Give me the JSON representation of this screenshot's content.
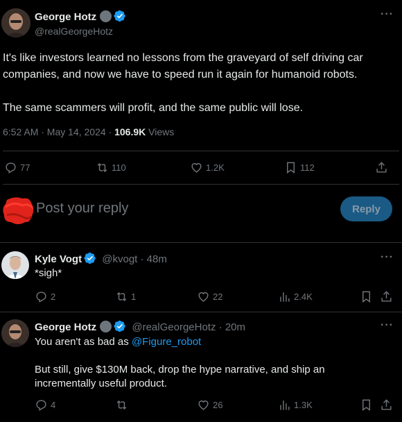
{
  "main_post": {
    "author_name": "George Hotz",
    "author_handle": "@realGeorgeHotz",
    "paragraph1_line1": "It's like investors learned no lessons from the graveyard of self driving car",
    "paragraph1_line2": "companies, and now we have to speed run it again for humanoid robots.",
    "paragraph2": "The same scammers will profit, and the same public will lose.",
    "time": "6:52 AM · May 14, 2024 · ",
    "views_count": "106.9K",
    "views_label": " Views",
    "stats": {
      "replies": "77",
      "reposts": "110",
      "likes": "1.2K",
      "bookmarks": "112"
    }
  },
  "reply_box": {
    "placeholder": "Post your reply",
    "button_label": "Reply"
  },
  "replies": [
    {
      "author_name": "Kyle Vogt",
      "author_handle": "@kvogt",
      "time": " · 48m",
      "text": "*sigh*",
      "stats": {
        "replies": "2",
        "reposts": "1",
        "likes": "22",
        "views": "2.4K"
      }
    },
    {
      "author_name": "George Hotz",
      "author_handle": "@realGeorgeHotz",
      "time": " · 20m",
      "text_prefix": "You aren't as bad as ",
      "mention": "@Figure_robot",
      "text_line2": "But still, give $130M back, drop the hype narrative, and ship an",
      "text_line3": "incrementally useful product.",
      "stats": {
        "replies": "4",
        "reposts": "",
        "likes": "26",
        "views": "1.3K"
      }
    }
  ],
  "colors": {
    "accent": "#1d9bf0",
    "muted": "#71767b",
    "divider": "#2f3336",
    "reply_button": "#1a5a85",
    "scribble": "#e0241b"
  },
  "icons": [
    "more-icon",
    "verified-icon",
    "reply-icon",
    "repost-icon",
    "like-icon",
    "bookmark-icon",
    "share-icon",
    "views-icon"
  ]
}
